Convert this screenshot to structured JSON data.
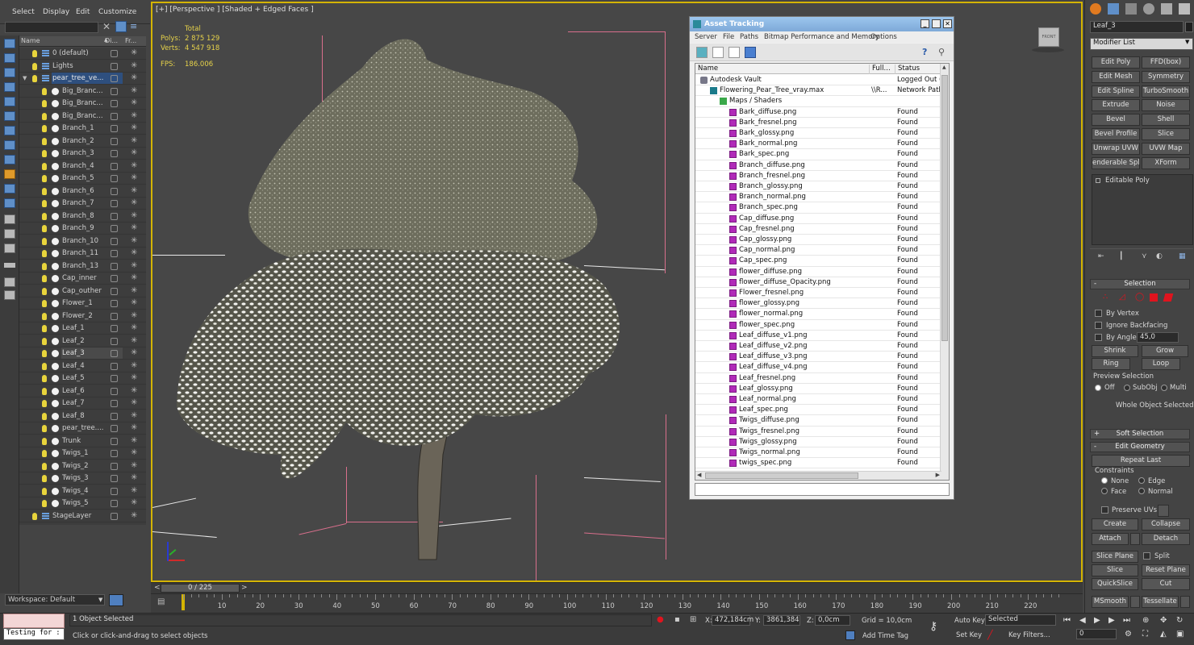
{
  "menu": [
    "Select",
    "Display",
    "Edit",
    "Customize"
  ],
  "scene_explorer": {
    "columns": [
      "Name",
      "Di...",
      "Fr..."
    ],
    "items": [
      {
        "name": "0 (default)",
        "type": "layer",
        "indent": 1
      },
      {
        "name": "Lights",
        "type": "layer",
        "indent": 1
      },
      {
        "name": "pear_tree_ve...",
        "type": "layer",
        "indent": 1,
        "highlight": true
      },
      {
        "name": "Big_Branc...",
        "type": "obj",
        "indent": 2
      },
      {
        "name": "Big_Branc...",
        "type": "obj",
        "indent": 2
      },
      {
        "name": "Big_Branc...",
        "type": "obj",
        "indent": 2
      },
      {
        "name": "Branch_1",
        "type": "obj",
        "indent": 2
      },
      {
        "name": "Branch_2",
        "type": "obj",
        "indent": 2
      },
      {
        "name": "Branch_3",
        "type": "obj",
        "indent": 2
      },
      {
        "name": "Branch_4",
        "type": "obj",
        "indent": 2
      },
      {
        "name": "Branch_5",
        "type": "obj",
        "indent": 2
      },
      {
        "name": "Branch_6",
        "type": "obj",
        "indent": 2
      },
      {
        "name": "Branch_7",
        "type": "obj",
        "indent": 2
      },
      {
        "name": "Branch_8",
        "type": "obj",
        "indent": 2
      },
      {
        "name": "Branch_9",
        "type": "obj",
        "indent": 2
      },
      {
        "name": "Branch_10",
        "type": "obj",
        "indent": 2
      },
      {
        "name": "Branch_11",
        "type": "obj",
        "indent": 2
      },
      {
        "name": "Branch_13",
        "type": "obj",
        "indent": 2
      },
      {
        "name": "Cap_inner",
        "type": "obj",
        "indent": 2
      },
      {
        "name": "Cap_outher",
        "type": "obj",
        "indent": 2
      },
      {
        "name": "Flower_1",
        "type": "obj",
        "indent": 2
      },
      {
        "name": "Flower_2",
        "type": "obj",
        "indent": 2
      },
      {
        "name": "Leaf_1",
        "type": "obj",
        "indent": 2
      },
      {
        "name": "Leaf_2",
        "type": "obj",
        "indent": 2
      },
      {
        "name": "Leaf_3",
        "type": "obj",
        "indent": 2,
        "selected": true
      },
      {
        "name": "Leaf_4",
        "type": "obj",
        "indent": 2
      },
      {
        "name": "Leaf_5",
        "type": "obj",
        "indent": 2
      },
      {
        "name": "Leaf_6",
        "type": "obj",
        "indent": 2
      },
      {
        "name": "Leaf_7",
        "type": "obj",
        "indent": 2
      },
      {
        "name": "Leaf_8",
        "type": "obj",
        "indent": 2
      },
      {
        "name": "pear_tree....",
        "type": "obj",
        "indent": 2
      },
      {
        "name": "Trunk",
        "type": "obj",
        "indent": 2
      },
      {
        "name": "Twigs_1",
        "type": "obj",
        "indent": 2
      },
      {
        "name": "Twigs_2",
        "type": "obj",
        "indent": 2
      },
      {
        "name": "Twigs_3",
        "type": "obj",
        "indent": 2
      },
      {
        "name": "Twigs_4",
        "type": "obj",
        "indent": 2
      },
      {
        "name": "Twigs_5",
        "type": "obj",
        "indent": 2
      },
      {
        "name": "StageLayer",
        "type": "layer",
        "indent": 1
      }
    ],
    "workspace": "Workspace: Default"
  },
  "viewport": {
    "label": "[+] [Perspective ] [Shaded + Edged Faces ]",
    "stats": {
      "total_label": "Total",
      "polys_label": "Polys:",
      "polys": "2 875 129",
      "verts_label": "Verts:",
      "verts": "4 547 918",
      "fps_label": "FPS:",
      "fps": "186.006"
    },
    "viewcube_label": "FRONT"
  },
  "time_slider": {
    "label": "0 / 225",
    "prev": "<",
    "next": ">"
  },
  "timeline": {
    "ticks": [
      "10",
      "20",
      "30",
      "40",
      "50",
      "60",
      "70",
      "80",
      "90",
      "100",
      "110",
      "120",
      "130",
      "140",
      "150",
      "160",
      "170",
      "180",
      "190",
      "200",
      "210",
      "220"
    ]
  },
  "status": {
    "script_label": "Testing for :",
    "selected_text": "1 Object Selected",
    "prompt_text": "Click or click-and-drag to select objects",
    "x_label": "X:",
    "x_value": "472,184cm",
    "y_label": "Y:",
    "y_value": "3861,384",
    "z_label": "Z:",
    "z_value": "0,0cm",
    "grid": "Grid = 10,0cm",
    "add_time_tag": "Add Time Tag",
    "auto_key": "Auto Key",
    "set_key": "Set Key",
    "selected_dropdown": "Selected",
    "key_filters": "Key Filters...",
    "frame": "0"
  },
  "command_panel": {
    "object_name": "Leaf_3",
    "modifier_list": "Modifier List",
    "modifier_buttons": [
      [
        "Edit Poly",
        "FFD(box)"
      ],
      [
        "Edit Mesh",
        "Symmetry"
      ],
      [
        "Edit Spline",
        "TurboSmooth"
      ],
      [
        "Extrude",
        "Noise"
      ],
      [
        "Bevel",
        "Shell"
      ],
      [
        "Bevel Profile",
        "Slice"
      ],
      [
        "Unwrap UVW",
        "UVW Map"
      ],
      [
        "enderable Splin",
        "XForm"
      ]
    ],
    "stack_item": "Editable Poly",
    "selection": {
      "header": "Selection",
      "by_vertex": "By Vertex",
      "ignore_backfacing": "Ignore Backfacing",
      "by_angle": "By Angle:",
      "angle_value": "45,0",
      "shrink": "Shrink",
      "grow": "Grow",
      "ring": "Ring",
      "loop": "Loop",
      "preview_label": "Preview Selection",
      "preview_off": "Off",
      "preview_subobj": "SubObj",
      "preview_multi": "Multi",
      "whole_object": "Whole Object Selected"
    },
    "soft_selection": "Soft Selection",
    "edit_geometry": {
      "header": "Edit Geometry",
      "repeat_last": "Repeat Last",
      "constraints": "Constraints",
      "none": "None",
      "edge": "Edge",
      "face": "Face",
      "normal": "Normal",
      "preserve_uvs": "Preserve UVs",
      "create": "Create",
      "collapse": "Collapse",
      "attach": "Attach",
      "detach": "Detach",
      "slice_plane": "Slice Plane",
      "split": "Split",
      "slice": "Slice",
      "reset_plane": "Reset Plane",
      "quickslice": "QuickSlice",
      "cut": "Cut",
      "msmooth": "MSmooth",
      "tessellate": "Tessellate"
    }
  },
  "asset_tracking": {
    "title": "Asset Tracking",
    "menus": [
      "Server",
      "File",
      "Paths",
      "Bitmap Performance and Memory",
      "Options"
    ],
    "columns": [
      "Name",
      "Full...",
      "Status"
    ],
    "rows": [
      {
        "name": "Autodesk Vault",
        "full": "",
        "status": "Logged Out (...",
        "icon": "vault",
        "indent": 0
      },
      {
        "name": "Flowering_Pear_Tree_vray.max",
        "full": "\\\\R...",
        "status": "Network Path",
        "icon": "max",
        "indent": 1
      },
      {
        "name": "Maps / Shaders",
        "full": "",
        "status": "",
        "icon": "folder",
        "indent": 2
      },
      {
        "name": "Bark_diffuse.png",
        "full": "",
        "status": "Found",
        "icon": "png",
        "indent": 3
      },
      {
        "name": "Bark_fresnel.png",
        "full": "",
        "status": "Found",
        "icon": "png",
        "indent": 3
      },
      {
        "name": "Bark_glossy.png",
        "full": "",
        "status": "Found",
        "icon": "png",
        "indent": 3
      },
      {
        "name": "Bark_normal.png",
        "full": "",
        "status": "Found",
        "icon": "png",
        "indent": 3
      },
      {
        "name": "Bark_spec.png",
        "full": "",
        "status": "Found",
        "icon": "png",
        "indent": 3
      },
      {
        "name": "Branch_diffuse.png",
        "full": "",
        "status": "Found",
        "icon": "png",
        "indent": 3
      },
      {
        "name": "Branch_fresnel.png",
        "full": "",
        "status": "Found",
        "icon": "png",
        "indent": 3
      },
      {
        "name": "Branch_glossy.png",
        "full": "",
        "status": "Found",
        "icon": "png",
        "indent": 3
      },
      {
        "name": "Branch_normal.png",
        "full": "",
        "status": "Found",
        "icon": "png",
        "indent": 3
      },
      {
        "name": "Branch_spec.png",
        "full": "",
        "status": "Found",
        "icon": "png",
        "indent": 3
      },
      {
        "name": "Cap_diffuse.png",
        "full": "",
        "status": "Found",
        "icon": "png",
        "indent": 3
      },
      {
        "name": "Cap_fresnel.png",
        "full": "",
        "status": "Found",
        "icon": "png",
        "indent": 3
      },
      {
        "name": "Cap_glossy.png",
        "full": "",
        "status": "Found",
        "icon": "png",
        "indent": 3
      },
      {
        "name": "Cap_normal.png",
        "full": "",
        "status": "Found",
        "icon": "png",
        "indent": 3
      },
      {
        "name": "Cap_spec.png",
        "full": "",
        "status": "Found",
        "icon": "png",
        "indent": 3
      },
      {
        "name": "flower_diffuse.png",
        "full": "",
        "status": "Found",
        "icon": "png",
        "indent": 3
      },
      {
        "name": "flower_diffuse_Opacity.png",
        "full": "",
        "status": "Found",
        "icon": "png",
        "indent": 3
      },
      {
        "name": "Flower_fresnel.png",
        "full": "",
        "status": "Found",
        "icon": "png",
        "indent": 3
      },
      {
        "name": "flower_glossy.png",
        "full": "",
        "status": "Found",
        "icon": "png",
        "indent": 3
      },
      {
        "name": "flower_normal.png",
        "full": "",
        "status": "Found",
        "icon": "png",
        "indent": 3
      },
      {
        "name": "flower_spec.png",
        "full": "",
        "status": "Found",
        "icon": "png",
        "indent": 3
      },
      {
        "name": "Leaf_diffuse_v1.png",
        "full": "",
        "status": "Found",
        "icon": "png",
        "indent": 3
      },
      {
        "name": "Leaf_diffuse_v2.png",
        "full": "",
        "status": "Found",
        "icon": "png",
        "indent": 3
      },
      {
        "name": "Leaf_diffuse_v3.png",
        "full": "",
        "status": "Found",
        "icon": "png",
        "indent": 3
      },
      {
        "name": "Leaf_diffuse_v4.png",
        "full": "",
        "status": "Found",
        "icon": "png",
        "indent": 3
      },
      {
        "name": "Leaf_fresnel.png",
        "full": "",
        "status": "Found",
        "icon": "png",
        "indent": 3
      },
      {
        "name": "Leaf_glossy.png",
        "full": "",
        "status": "Found",
        "icon": "png",
        "indent": 3
      },
      {
        "name": "Leaf_normal.png",
        "full": "",
        "status": "Found",
        "icon": "png",
        "indent": 3
      },
      {
        "name": "Leaf_spec.png",
        "full": "",
        "status": "Found",
        "icon": "png",
        "indent": 3
      },
      {
        "name": "Twigs_diffuse.png",
        "full": "",
        "status": "Found",
        "icon": "png",
        "indent": 3
      },
      {
        "name": "Twigs_fresnel.png",
        "full": "",
        "status": "Found",
        "icon": "png",
        "indent": 3
      },
      {
        "name": "Twigs_glossy.png",
        "full": "",
        "status": "Found",
        "icon": "png",
        "indent": 3
      },
      {
        "name": "Twigs_normal.png",
        "full": "",
        "status": "Found",
        "icon": "png",
        "indent": 3
      },
      {
        "name": "twigs_spec.png",
        "full": "",
        "status": "Found",
        "icon": "png",
        "indent": 3
      }
    ]
  },
  "colors": {
    "viewport_border": "#d4b400",
    "stats_text": "#e6d24a",
    "selection_red": "#e0141e",
    "png_icon": "#b02ab8"
  }
}
